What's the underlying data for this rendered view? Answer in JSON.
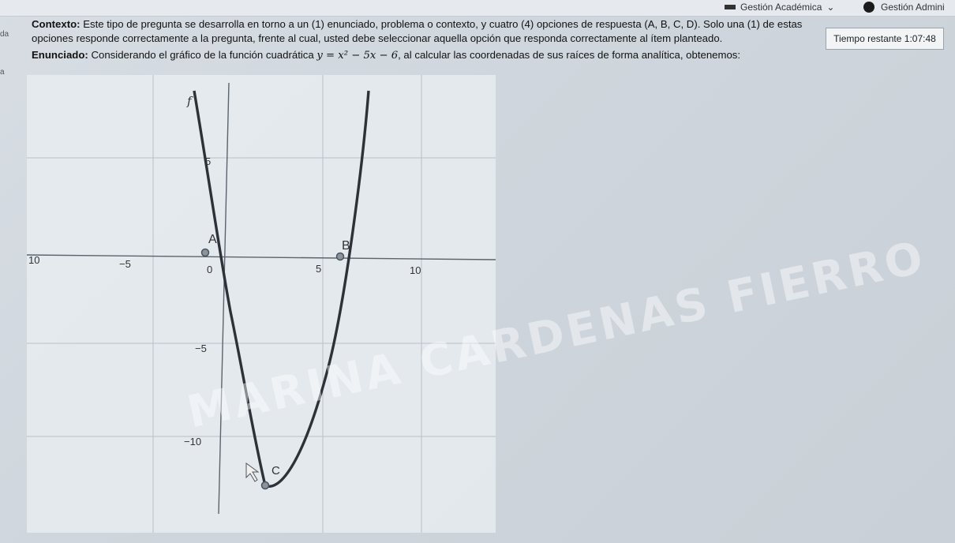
{
  "nav": {
    "gestion_academica": "Gestión Académica",
    "gestion_admin": "Gestión Admini"
  },
  "left_strip": {
    "text1": "da",
    "text2": "a"
  },
  "question": {
    "contexto_label": "Contexto:",
    "contexto_text": "Este tipo de pregunta se desarrolla en torno a un (1) enunciado, problema o contexto, y cuatro (4) opciones de respuesta (A, B, C, D). Solo una (1) de estas opciones responde correctamente a la pregunta, frente al cual, usted debe seleccionar aquella opción que responda correctamente al ítem planteado.",
    "enunciado_label": "Enunciado:",
    "enunciado_before": "Considerando el gráfico de la función cuadrática",
    "formula": "y = x² − 5x − 6",
    "enunciado_after": ", al calcular las coordenadas de sus raíces de forma analítica, obtenemos:"
  },
  "timer": {
    "label": "Tiempo restante",
    "value": "1:07:48"
  },
  "graph": {
    "function_label": "f",
    "x_ticks": [
      "10",
      "−5",
      "0",
      "5",
      "10"
    ],
    "y_ticks": [
      "5",
      "−5",
      "−10"
    ],
    "points": {
      "A": "A",
      "B": "B",
      "C": "C"
    }
  },
  "watermark": "MARINA CARDENAS FIERRO"
}
